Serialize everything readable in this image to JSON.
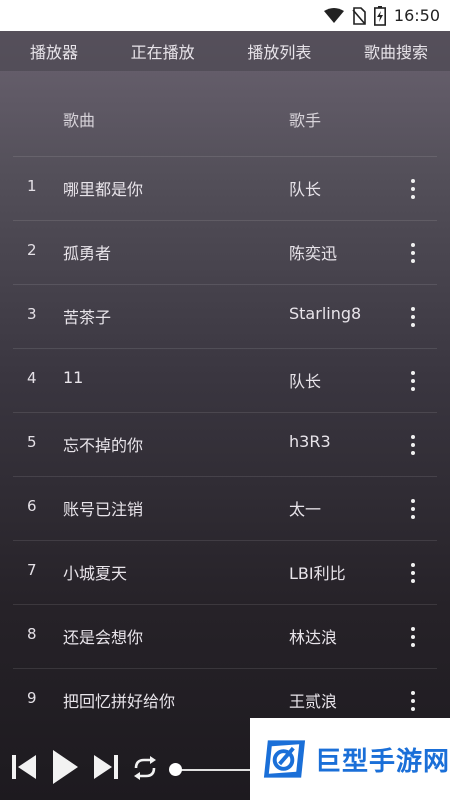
{
  "status_bar": {
    "time": "16:50",
    "icons": [
      "wifi-icon",
      "no-sim-icon",
      "battery-icon"
    ]
  },
  "tabs": [
    {
      "label": "播放器"
    },
    {
      "label": "正在播放"
    },
    {
      "label": "播放列表"
    },
    {
      "label": "歌曲搜索"
    }
  ],
  "list_header": {
    "song": "歌曲",
    "artist": "歌手"
  },
  "songs": [
    {
      "num": "1",
      "title": "哪里都是你",
      "artist": "队长"
    },
    {
      "num": "2",
      "title": "孤勇者",
      "artist": "陈奕迅"
    },
    {
      "num": "3",
      "title": "苦茶子",
      "artist": "Starling8"
    },
    {
      "num": "4",
      "title": "11",
      "artist": "队长"
    },
    {
      "num": "5",
      "title": "忘不掉的你",
      "artist": "h3R3"
    },
    {
      "num": "6",
      "title": "账号已注销",
      "artist": "太一"
    },
    {
      "num": "7",
      "title": "小城夏天",
      "artist": "LBI利比"
    },
    {
      "num": "8",
      "title": "还是会想你",
      "artist": "林达浪"
    },
    {
      "num": "9",
      "title": "把回忆拼好给你",
      "artist": "王贰浪"
    }
  ],
  "player": {
    "controls": [
      "previous-icon",
      "play-icon",
      "next-icon",
      "repeat-icon"
    ],
    "progress": 0
  },
  "watermark": {
    "text": "巨型手游网"
  },
  "colors": {
    "accent": "#1a6fd8",
    "text": "#e8e4ea"
  }
}
